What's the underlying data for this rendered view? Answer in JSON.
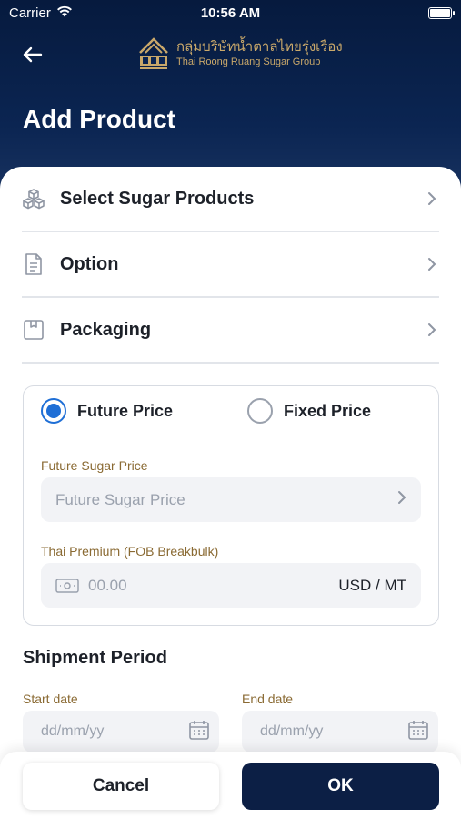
{
  "status_bar": {
    "carrier": "Carrier",
    "time": "10:56 AM"
  },
  "header": {
    "logo_thai": "กลุ่มบริษัทน้ำตาลไทยรุ่งเรือง",
    "logo_eng": "Thai Roong Ruang Sugar Group",
    "title": "Add Product"
  },
  "menu": [
    {
      "label": "Select Sugar Products",
      "icon": "boxes-icon"
    },
    {
      "label": "Option",
      "icon": "document-icon"
    },
    {
      "label": "Packaging",
      "icon": "package-icon"
    }
  ],
  "price_type": {
    "options": [
      "Future Price",
      "Fixed Price"
    ],
    "selected": "Future Price"
  },
  "future_sugar_price": {
    "label": "Future Sugar Price",
    "placeholder": "Future Sugar Price"
  },
  "thai_premium": {
    "label": "Thai Premium (FOB Breakbulk)",
    "placeholder": "00.00",
    "unit": "USD / MT"
  },
  "shipment": {
    "title": "Shipment Period",
    "start_label": "Start date",
    "start_placeholder": "dd/mm/yy",
    "end_label": "End date",
    "end_placeholder": "dd/mm/yy"
  },
  "footer": {
    "cancel_label": "Cancel",
    "ok_label": "OK"
  },
  "colors": {
    "header_bg": "#0b2552",
    "accent": "#1f6fd6",
    "gold": "#8a6a33",
    "ok_bg": "#0c1f45"
  }
}
